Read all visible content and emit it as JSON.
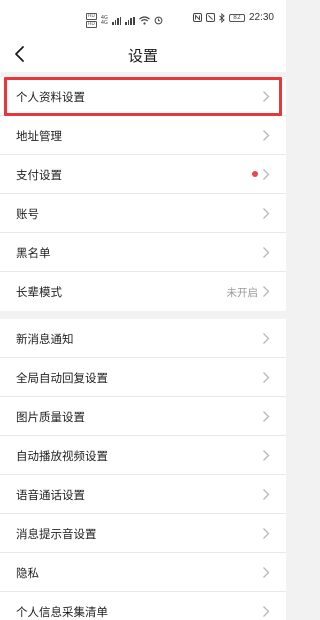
{
  "status_bar": {
    "hd_top": "HD",
    "hd_bottom": "HD",
    "network_top": "4G",
    "network_bottom": "4G",
    "battery": "82",
    "time": "22:30",
    "icons": [
      "nfc-icon",
      "mute-icon",
      "bluetooth-icon",
      "battery-icon"
    ]
  },
  "header": {
    "title": "设置"
  },
  "group1": [
    {
      "label": "个人资料设置"
    },
    {
      "label": "地址管理"
    },
    {
      "label": "支付设置",
      "dot_color": "#f0434b"
    },
    {
      "label": "账号"
    },
    {
      "label": "黑名单"
    },
    {
      "label": "长辈模式",
      "value": "未开启"
    }
  ],
  "group2": [
    {
      "label": "新消息通知"
    },
    {
      "label": "全局自动回复设置"
    },
    {
      "label": "图片质量设置"
    },
    {
      "label": "自动播放视频设置"
    },
    {
      "label": "语音通话设置"
    },
    {
      "label": "消息提示音设置"
    },
    {
      "label": "隐私"
    },
    {
      "label": "个人信息采集清单"
    }
  ],
  "colors": {
    "highlight": "#e8363d",
    "background": "#f2f2f2"
  }
}
